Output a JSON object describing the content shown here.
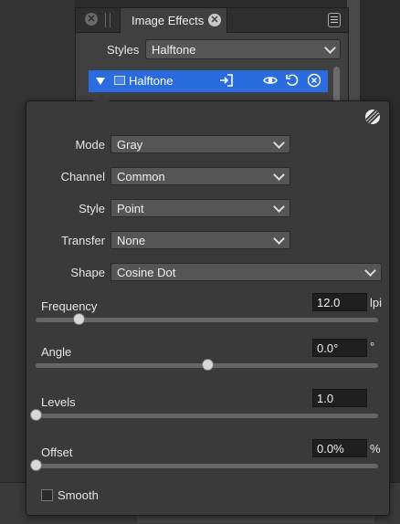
{
  "panel": {
    "title": "Image Effects",
    "styles_label": "Styles",
    "styles_value": "Halftone",
    "effect_name": "Halftone",
    "icons": [
      "close-icon",
      "tab-close-icon",
      "panel-menu-icon",
      "layer-thumb-icon",
      "export-icon",
      "eye-icon",
      "reset-icon",
      "remove-icon"
    ]
  },
  "popover": {
    "icon": "halftone-icon",
    "fields": [
      {
        "label": "Mode",
        "value": "Gray"
      },
      {
        "label": "Channel",
        "value": "Common"
      },
      {
        "label": "Style",
        "value": "Point"
      },
      {
        "label": "Transfer",
        "value": "None"
      },
      {
        "label": "Shape",
        "value": "Cosine Dot"
      }
    ],
    "sliders": [
      {
        "label": "Frequency",
        "value": "12.0",
        "unit": "lpi",
        "fraction": 0.125
      },
      {
        "label": "Angle",
        "value": "0.0°",
        "unit": "°",
        "fraction": 0.5
      },
      {
        "label": "Levels",
        "value": "1.0",
        "unit": "",
        "fraction": 0.0
      },
      {
        "label": "Offset",
        "value": "0.0%",
        "unit": "%",
        "fraction": 0.0
      }
    ],
    "smooth_label": "Smooth",
    "smooth_checked": false
  },
  "colors": {
    "accent": "#2a6be0",
    "panel": "#3a3a3a"
  }
}
